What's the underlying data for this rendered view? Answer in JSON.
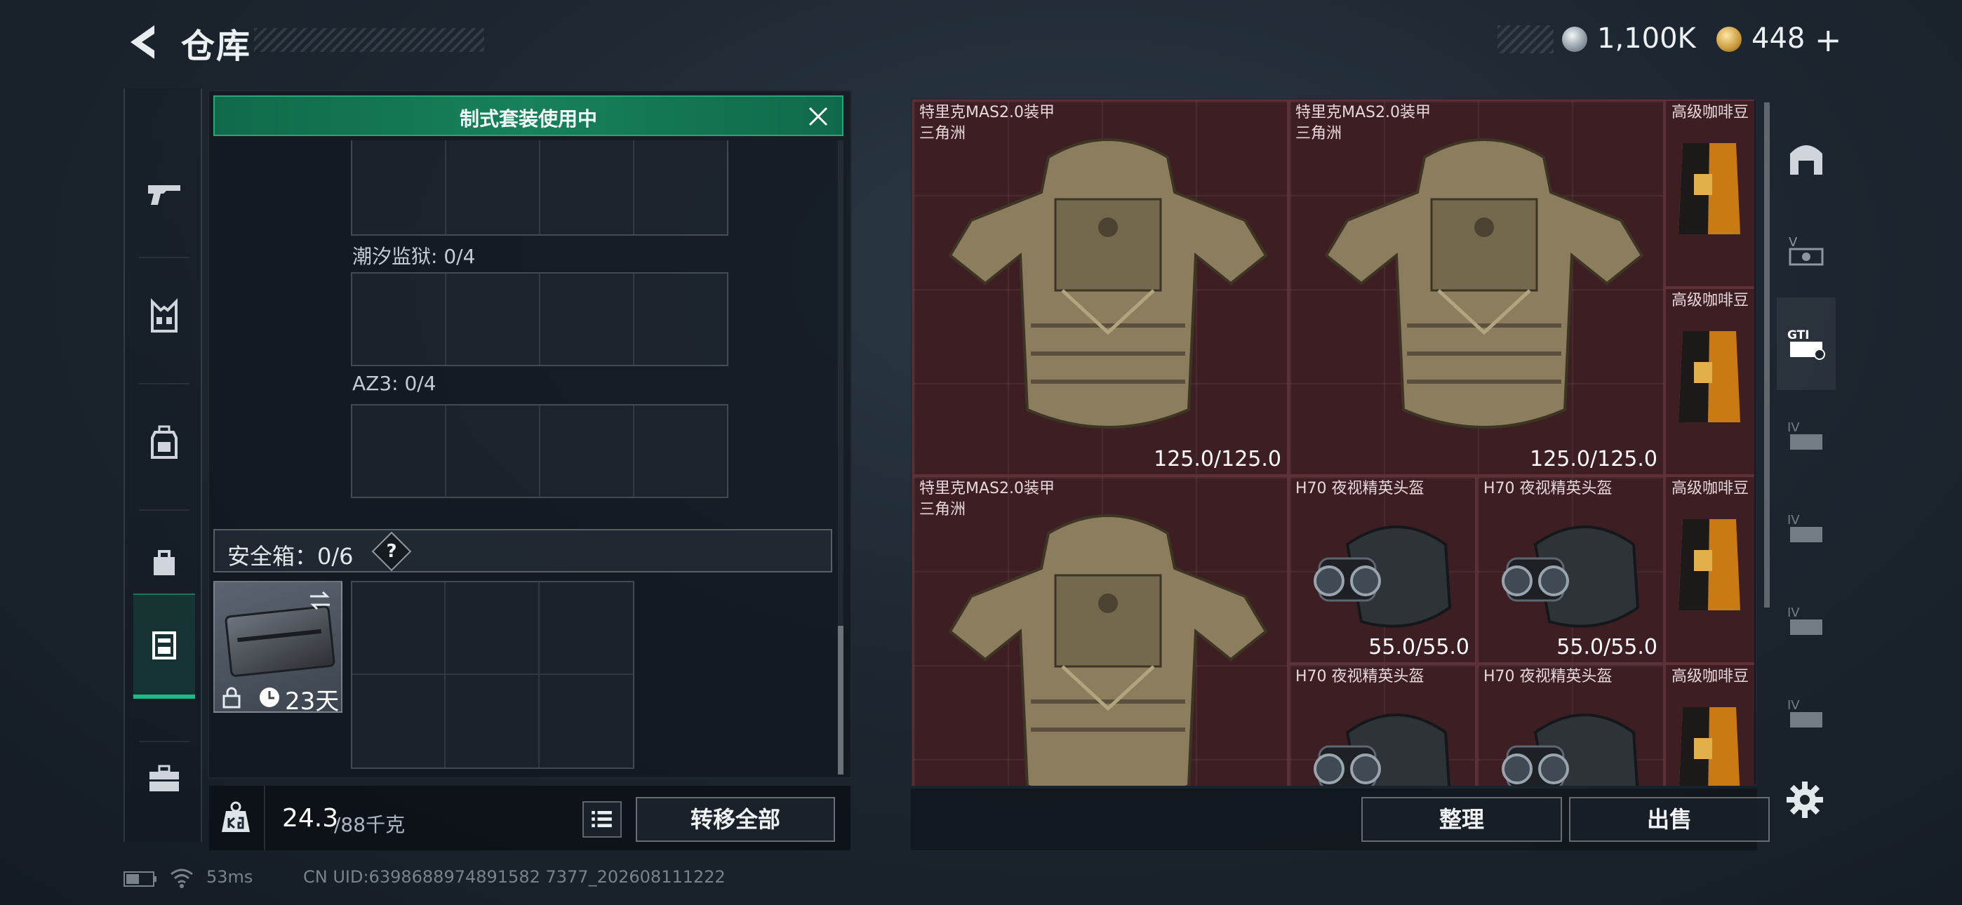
{
  "header": {
    "title": "仓库",
    "currency": [
      {
        "name": "silver-coin",
        "value": "1,100K"
      },
      {
        "name": "gold-coin",
        "value": "448"
      }
    ],
    "add_label": "+"
  },
  "left_nav": {
    "items": [
      {
        "icon": "pistol-icon"
      },
      {
        "icon": "vest-icon"
      },
      {
        "icon": "backpack-icon"
      },
      {
        "icon": "pouch-icon"
      },
      {
        "icon": "safe-box-icon"
      },
      {
        "icon": "briefcase-icon"
      }
    ],
    "active_index": 4
  },
  "storage": {
    "kit_banner": "制式套装使用中",
    "slots": [
      {
        "label": ""
      },
      {
        "label": "潮汐监狱: 0/4"
      },
      {
        "label": "AZ3: 0/4"
      }
    ],
    "safe_box": {
      "label": "安全箱：0/6",
      "help": "?",
      "days_left": "23天"
    },
    "weight": {
      "current": "24.3",
      "max": "/88千克"
    },
    "transfer_all": "转移全部"
  },
  "stash": {
    "items": [
      {
        "type": "armor",
        "name": "特里克MAS2.0装甲",
        "sub": "三角洲",
        "durability": "125.0/125.0"
      },
      {
        "type": "armor",
        "name": "特里克MAS2.0装甲",
        "sub": "三角洲",
        "durability": "125.0/125.0"
      },
      {
        "type": "coffee",
        "name": "高级咖啡豆"
      },
      {
        "type": "coffee",
        "name": "高级咖啡豆"
      },
      {
        "type": "armor",
        "name": "特里克MAS2.0装甲",
        "sub": "三角洲",
        "durability": ""
      },
      {
        "type": "helmet",
        "name": "H70 夜视精英头盔",
        "durability": "55.0/55.0"
      },
      {
        "type": "helmet",
        "name": "H70 夜视精英头盔",
        "durability": "55.0/55.0"
      },
      {
        "type": "coffee",
        "name": "高级咖啡豆"
      },
      {
        "type": "helmet",
        "name": "H70 夜视精英头盔",
        "durability": ""
      },
      {
        "type": "helmet",
        "name": "H70 夜视精英头盔",
        "durability": ""
      },
      {
        "type": "coffee",
        "name": "高级咖啡豆"
      }
    ],
    "sort": "整理",
    "sell": "出售",
    "item_colors": {
      "background": "#3d1e23",
      "border": "#5e3138"
    }
  },
  "page_nav": {
    "tabs": [
      {
        "icon": "vault-icon",
        "label": ""
      },
      {
        "icon": "stash-v-icon",
        "label": "V"
      },
      {
        "icon": "stash-gti-icon",
        "label": "GTI"
      },
      {
        "icon": "stash-iv-1-icon",
        "label": "IV"
      },
      {
        "icon": "stash-iv-2-icon",
        "label": "IV"
      },
      {
        "icon": "stash-iv-3-icon",
        "label": "IV"
      },
      {
        "icon": "stash-iv-4-icon",
        "label": "IV"
      }
    ],
    "active_index": 2
  },
  "status": {
    "ping": "53ms",
    "uid": "CN UID:6398688974891582 7377_202608111222"
  },
  "colors": {
    "accent_green": "#1fb887",
    "banner_green": "#178159",
    "item_bg": "#3d1e23"
  }
}
